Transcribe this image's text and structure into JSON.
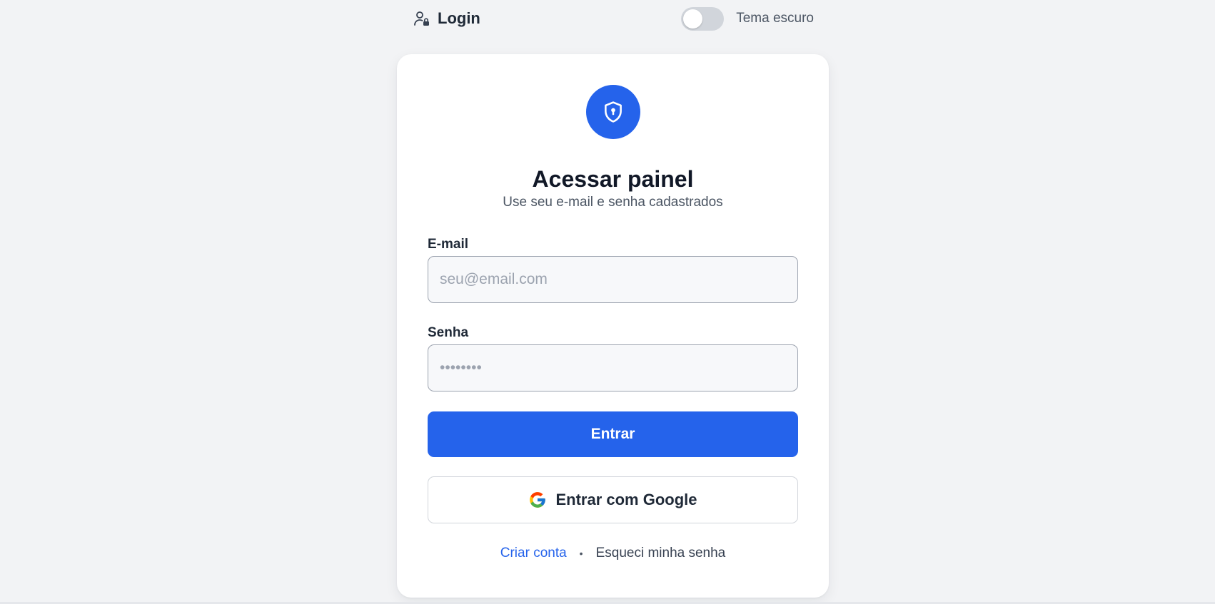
{
  "header": {
    "title": "Login",
    "icon": "user-lock-icon",
    "theme_toggle": {
      "label": "Tema escuro",
      "checked": false
    }
  },
  "card": {
    "badge_icon": "shield-keyhole-icon",
    "title": "Acessar painel",
    "subtitle": "Use seu e-mail e senha cadastrados",
    "email": {
      "label": "E-mail",
      "placeholder": "seu@email.com",
      "value": ""
    },
    "password": {
      "label": "Senha",
      "placeholder": "••••••••",
      "value": ""
    },
    "submit_label": "Entrar",
    "google_label": "Entrar com Google",
    "google_icon": "google-icon",
    "links": {
      "create_account": "Criar conta",
      "separator": "•",
      "forgot_password": "Esqueci minha senha"
    }
  },
  "colors": {
    "primary": "#2563eb",
    "background": "#f2f3f5",
    "card": "#ffffff",
    "toggle_off": "#d1d5db"
  }
}
